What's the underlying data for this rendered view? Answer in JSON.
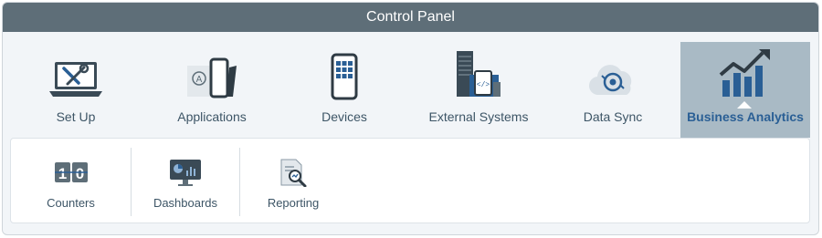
{
  "window": {
    "title": "Control Panel"
  },
  "nav": {
    "items": [
      {
        "label": "Set Up",
        "icon": "tools-laptop-icon"
      },
      {
        "label": "Applications",
        "icon": "applications-icon"
      },
      {
        "label": "Devices",
        "icon": "mobile-device-icon"
      },
      {
        "label": "External Systems",
        "icon": "external-systems-icon"
      },
      {
        "label": "Data Sync",
        "icon": "data-sync-icon"
      },
      {
        "label": "Business Analytics",
        "icon": "business-analytics-icon",
        "active": true
      }
    ]
  },
  "submenu": {
    "items": [
      {
        "label": "Counters",
        "icon": "counters-icon"
      },
      {
        "label": "Dashboards",
        "icon": "dashboards-icon"
      },
      {
        "label": "Reporting",
        "icon": "reporting-icon"
      }
    ]
  },
  "colors": {
    "titlebar": "#5e6e78",
    "panel_bg": "#f2f5f8",
    "active_tab": "#a9bac5",
    "active_label": "#2a5f95",
    "label": "#3d5566"
  }
}
